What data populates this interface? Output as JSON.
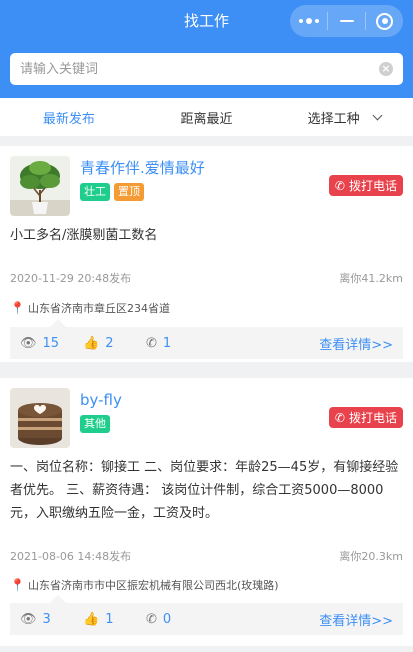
{
  "header": {
    "title": "找工作"
  },
  "search": {
    "placeholder": "请输入关键词"
  },
  "filters": [
    {
      "label": "最新发布",
      "active": true
    },
    {
      "label": "距离最近"
    },
    {
      "label": "选择工种"
    }
  ],
  "cards": [
    {
      "name": "青春作伴.爱情最好",
      "tags": [
        "壮工",
        "置顶"
      ],
      "call_label": "拨打电话",
      "description": "小工多名/涨膜剔菌工数名",
      "published": "2020-11-29 20:48发布",
      "distance": "离你41.2km",
      "address": "山东省济南市章丘区234省道",
      "views": "15",
      "likes": "2",
      "calls": "1",
      "detail_label": "查看详情>>"
    },
    {
      "name": "by-fly",
      "tags": [
        "其他"
      ],
      "call_label": "拨打电话",
      "description": "一、岗位名称：铆接工 二、岗位要求：年龄25—45岁，有铆接经验者优先。 三、薪资待遇： 该岗位计件制，综合工资5000—8000元，入职缴纳五险一金，工资及时。",
      "published": "2021-08-06 14:48发布",
      "distance": "离你20.3km",
      "address": "山东省济南市市中区振宏机械有限公司西北(玫瑰路)",
      "views": "3",
      "likes": "1",
      "calls": "0",
      "detail_label": "查看详情>>"
    }
  ],
  "colors": {
    "accent": "#3d8ff5",
    "call": "#e8434c",
    "tag_green": "#1fce8c",
    "tag_orange": "#f49b34"
  }
}
